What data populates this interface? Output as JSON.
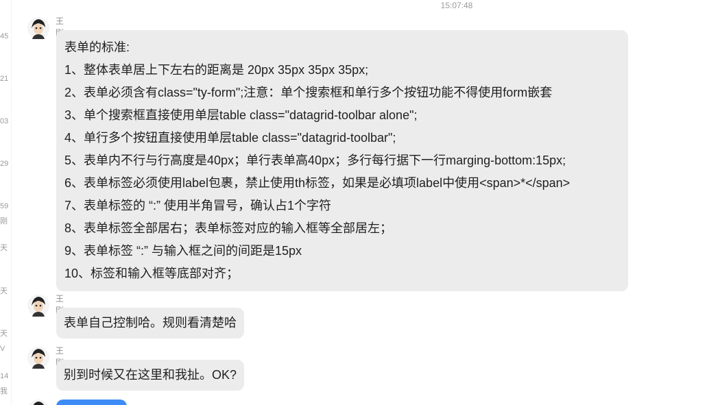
{
  "timestamp": "15:07:48",
  "left_list": [
    {
      "text": "45"
    },
    {
      "text": "21"
    },
    {
      "text": "03"
    },
    {
      "text": "29"
    },
    {
      "text": "59"
    },
    {
      "text": "刚"
    },
    {
      "text": "天"
    },
    {
      "text": "天"
    },
    {
      "text": "天"
    },
    {
      "text": "V"
    },
    {
      "text": "14"
    },
    {
      "text": "我"
    }
  ],
  "messages": [
    {
      "sender": "王刚",
      "lines": [
        "表单的标准:",
        "1、整体表单居上下左右的距离是 20px 35px 35px 35px;",
        "2、表单必须含有class=\"ty-form\";注意：单个搜索框和单行多个按钮功能不得使用form嵌套",
        "3、单个搜索框直接使用单层table class=\"datagrid-toolbar alone\";",
        "4、单行多个按钮直接使用单层table class=\"datagrid-toolbar\";",
        "5、表单内不行与行高度是40px；单行表单高40px；多行每行据下一行marging-bottom:15px;",
        "6、表单标签必须使用label包裹，禁止使用th标签，如果是必填项label中使用<span>*</span>",
        "7、表单标签的 “:” 使用半角冒号，确认占1个字符",
        "8、表单标签全部居右；表单标签对应的输入框等全部居左；",
        "9、表单标签 “:” 与输入框之间的间距是15px",
        "10、标签和输入框等底部对齐；"
      ]
    },
    {
      "sender": "王刚",
      "lines": [
        "表单自己控制哈。规则看清楚哈"
      ]
    },
    {
      "sender": "王刚",
      "lines": [
        "别到时候又在这里和我扯。OK?"
      ]
    }
  ],
  "colors": {
    "bubble_bg": "#ececec",
    "own_bubble": "#3d8cf5",
    "meta_text": "#9a9a9a"
  }
}
